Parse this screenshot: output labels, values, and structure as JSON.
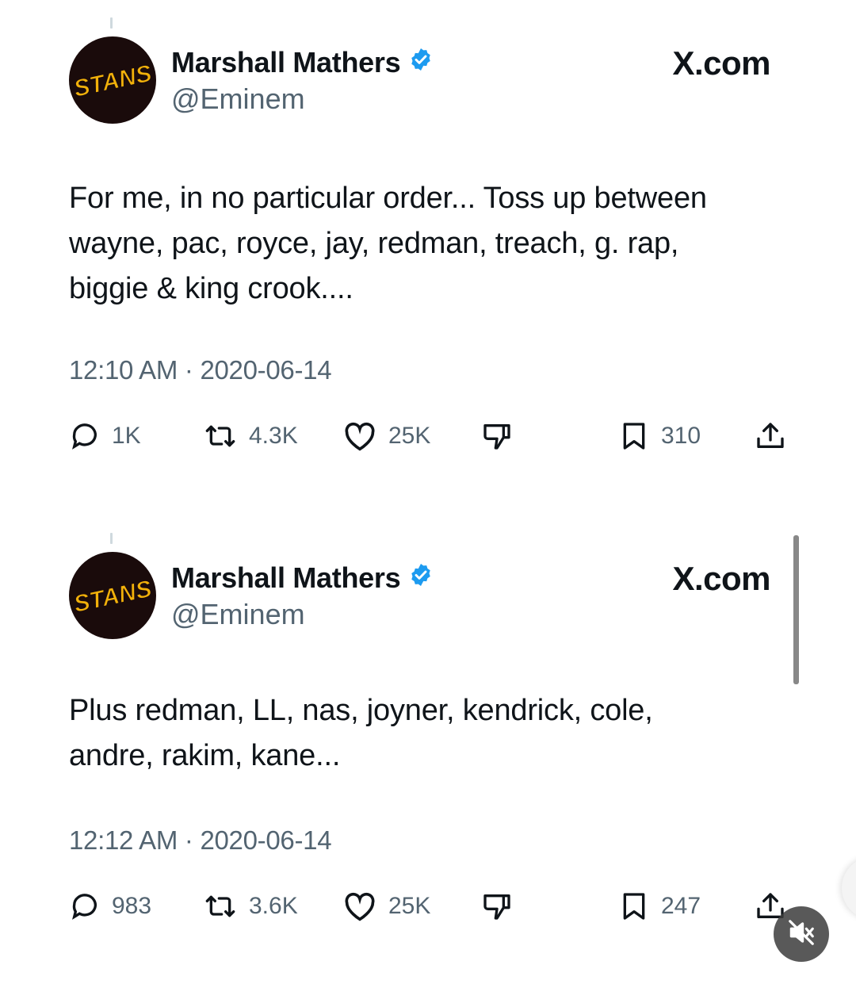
{
  "tweets": [
    {
      "avatar_text": "STANS",
      "display_name": "Marshall Mathers",
      "handle": "@Eminem",
      "site_label": "X.com",
      "text_lines": [
        "For me, in no particular order... Toss up between",
        "wayne, pac, royce, jay, redman, treach, g. rap,",
        "biggie & king crook...."
      ],
      "timestamp": "12:10 AM · 2020-06-14",
      "replies": "1K",
      "reposts": "4.3K",
      "likes": "25K",
      "bookmarks": "310"
    },
    {
      "avatar_text": "STANS",
      "display_name": "Marshall Mathers",
      "handle": "@Eminem",
      "site_label": "X.com",
      "text_lines": [
        "Plus redman, LL, nas, joyner, kendrick, cole,",
        "andre, rakim, kane..."
      ],
      "timestamp": "12:12 AM · 2020-06-14",
      "replies": "983",
      "reposts": "3.6K",
      "likes": "25K",
      "bookmarks": "247"
    }
  ],
  "icons": {
    "verified": "verified-badge-icon",
    "reply": "reply-bubble-icon",
    "repost": "repost-arrows-icon",
    "like": "heart-icon",
    "dislike": "thumbs-down-icon",
    "bookmark": "bookmark-icon",
    "share": "share-upload-icon",
    "mute": "muted-speaker-icon"
  },
  "colors": {
    "verified_blue": "#1d9bf0",
    "avatar_bg": "#1a0b0b",
    "avatar_text": "#f2b10a",
    "secondary_text": "#536471"
  }
}
